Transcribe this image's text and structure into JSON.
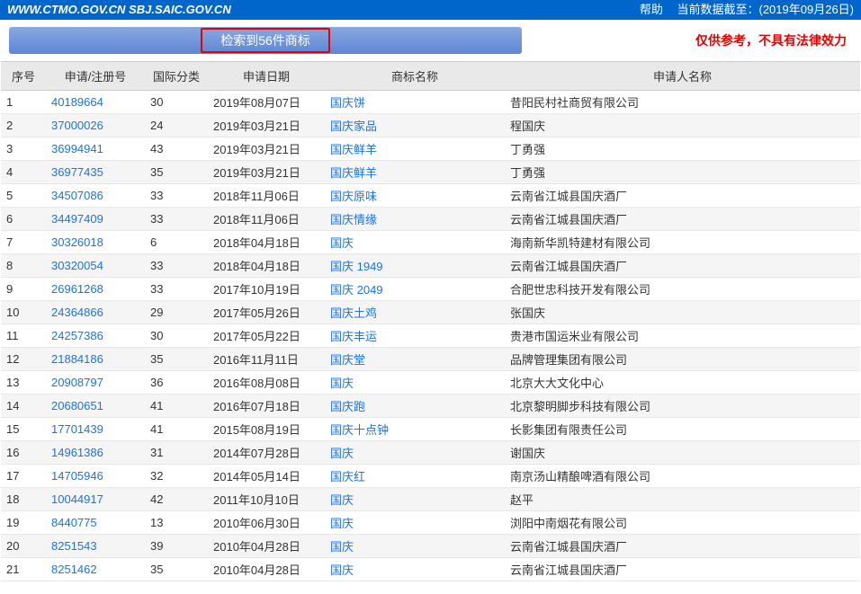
{
  "topbar": {
    "urls": "WWW.CTMO.GOV.CN SBJ.SAIC.GOV.CN",
    "help": "帮助",
    "data_date": "当前数据截至：(2019年09月26日)"
  },
  "result_label": "检索到56件商标",
  "disclaimer": "仅供参考，不具有法律效力",
  "columns": {
    "seq": "序号",
    "reg": "申请/注册号",
    "cls": "国际分类",
    "date": "申请日期",
    "name": "商标名称",
    "applicant": "申请人名称"
  },
  "rows": [
    {
      "seq": "1",
      "reg": "40189664",
      "cls": "30",
      "date": "2019年08月07日",
      "name": "国庆饼",
      "applicant": "昔阳民村社商贸有限公司"
    },
    {
      "seq": "2",
      "reg": "37000026",
      "cls": "24",
      "date": "2019年03月21日",
      "name": "国庆家品",
      "applicant": "程国庆"
    },
    {
      "seq": "3",
      "reg": "36994941",
      "cls": "43",
      "date": "2019年03月21日",
      "name": "国庆鲜羊",
      "applicant": "丁勇强"
    },
    {
      "seq": "4",
      "reg": "36977435",
      "cls": "35",
      "date": "2019年03月21日",
      "name": "国庆鲜羊",
      "applicant": "丁勇强"
    },
    {
      "seq": "5",
      "reg": "34507086",
      "cls": "33",
      "date": "2018年11月06日",
      "name": "国庆原味",
      "applicant": "云南省江城县国庆酒厂"
    },
    {
      "seq": "6",
      "reg": "34497409",
      "cls": "33",
      "date": "2018年11月06日",
      "name": "国庆情缘",
      "applicant": "云南省江城县国庆酒厂"
    },
    {
      "seq": "7",
      "reg": "30326018",
      "cls": "6",
      "date": "2018年04月18日",
      "name": "国庆",
      "applicant": "海南新华凯特建材有限公司"
    },
    {
      "seq": "8",
      "reg": "30320054",
      "cls": "33",
      "date": "2018年04月18日",
      "name": "国庆 1949",
      "applicant": "云南省江城县国庆酒厂"
    },
    {
      "seq": "9",
      "reg": "26961268",
      "cls": "33",
      "date": "2017年10月19日",
      "name": "国庆 2049",
      "applicant": "合肥世忠科技开发有限公司"
    },
    {
      "seq": "10",
      "reg": "24364866",
      "cls": "29",
      "date": "2017年05月26日",
      "name": "国庆土鸡",
      "applicant": "张国庆"
    },
    {
      "seq": "11",
      "reg": "24257386",
      "cls": "30",
      "date": "2017年05月22日",
      "name": "国庆丰运",
      "applicant": "贵港市国运米业有限公司"
    },
    {
      "seq": "12",
      "reg": "21884186",
      "cls": "35",
      "date": "2016年11月11日",
      "name": "国庆堂",
      "applicant": "品牌管理集团有限公司"
    },
    {
      "seq": "13",
      "reg": "20908797",
      "cls": "36",
      "date": "2016年08月08日",
      "name": "国庆",
      "applicant": "北京大大文化中心"
    },
    {
      "seq": "14",
      "reg": "20680651",
      "cls": "41",
      "date": "2016年07月18日",
      "name": "国庆跑",
      "applicant": "北京黎明脚步科技有限公司"
    },
    {
      "seq": "15",
      "reg": "17701439",
      "cls": "41",
      "date": "2015年08月19日",
      "name": "国庆十点钟",
      "applicant": "长影集团有限责任公司"
    },
    {
      "seq": "16",
      "reg": "14961386",
      "cls": "31",
      "date": "2014年07月28日",
      "name": "国庆",
      "applicant": "谢国庆"
    },
    {
      "seq": "17",
      "reg": "14705946",
      "cls": "32",
      "date": "2014年05月14日",
      "name": "国庆红",
      "applicant": "南京汤山精酿啤酒有限公司"
    },
    {
      "seq": "18",
      "reg": "10044917",
      "cls": "42",
      "date": "2011年10月10日",
      "name": "国庆",
      "applicant": "赵平"
    },
    {
      "seq": "19",
      "reg": "8440775",
      "cls": "13",
      "date": "2010年06月30日",
      "name": "国庆",
      "applicant": "浏阳中南烟花有限公司"
    },
    {
      "seq": "20",
      "reg": "8251543",
      "cls": "39",
      "date": "2010年04月28日",
      "name": "国庆",
      "applicant": "云南省江城县国庆酒厂"
    },
    {
      "seq": "21",
      "reg": "8251462",
      "cls": "35",
      "date": "2010年04月28日",
      "name": "国庆",
      "applicant": "云南省江城县国庆酒厂"
    }
  ]
}
